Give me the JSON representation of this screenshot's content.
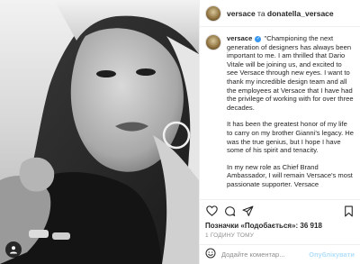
{
  "header": {
    "account": "versace",
    "connector": " та ",
    "collaborator": "donatella_versace"
  },
  "caption": {
    "username": "versace",
    "paragraphs": [
      "\"Championing the next generation of designers has always been important to me. I am thrilled that Dario Vitale will be joining us, and excited to see Versace through new eyes. I want to thank my incredible design team and all the employees at Versace that I have had the privilege of working with for over three decades.",
      "It has been the greatest honor of my life to carry on my brother Gianni's legacy. He was the true genius, but I hope I have some of his spirit and tenacity.",
      "In my new role as Chief Brand Ambassador, I will remain Versace's most passionate supporter. Versace"
    ]
  },
  "actions": {
    "likes_label": "Позначки «Подобається»: 36 918",
    "time_ago": "1 ГОДИНУ ТОМУ"
  },
  "comment_box": {
    "placeholder": "Додайте коментар...",
    "publish_label": "Опублікувати"
  },
  "icons": {
    "like": "heart-icon",
    "comment": "comment-bubble-icon",
    "share": "paper-plane-icon",
    "save": "bookmark-icon",
    "emoji": "smiley-icon",
    "tags": "user-tag-icon"
  },
  "colors": {
    "verified": "#3897f0",
    "publish_disabled": "#b2dffc",
    "secondary_text": "#8e8e8e"
  }
}
